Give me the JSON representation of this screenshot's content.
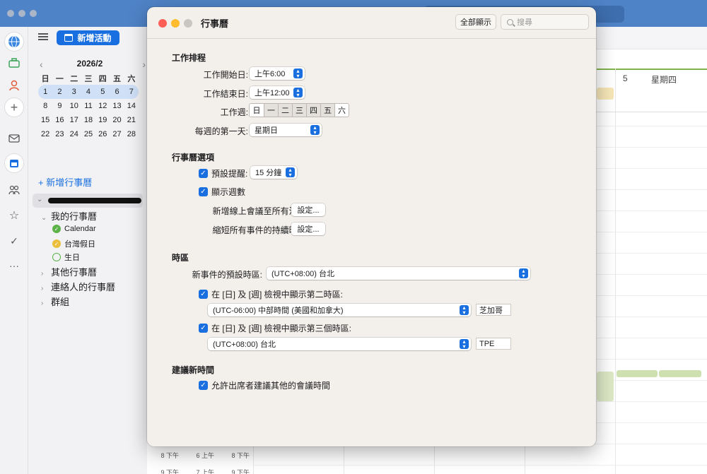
{
  "sidebar": {
    "new_event_label": "新增活動",
    "mini_cal": {
      "month_label": "2026/2",
      "dow": [
        "日",
        "一",
        "二",
        "三",
        "四",
        "五",
        "六"
      ],
      "weeks": [
        [
          "1",
          "2",
          "3",
          "4",
          "5",
          "6",
          "7"
        ],
        [
          "8",
          "9",
          "10",
          "11",
          "12",
          "13",
          "14"
        ],
        [
          "15",
          "16",
          "17",
          "18",
          "19",
          "20",
          "21"
        ],
        [
          "22",
          "23",
          "24",
          "25",
          "26",
          "27",
          "28"
        ]
      ]
    },
    "add_calendar": "+ 新增行事曆",
    "my_calendars": "我的行事曆",
    "cal_calendar": "Calendar",
    "cal_holidays": "台灣假日",
    "cal_birthdays": "生日",
    "other_calendars": "其他行事曆",
    "contacts_calendars": "連絡人的行事曆",
    "groups": "群組"
  },
  "main": {
    "day_num": "5",
    "day_name": "星期四",
    "time_rows": [
      {
        "a": "8 下午",
        "b": "6 上午",
        "c": "8 下午"
      },
      {
        "a": "9 下午",
        "b": "7 上午",
        "c": "9 下午"
      }
    ]
  },
  "dialog": {
    "title": "行事曆",
    "show_all": "全部顯示",
    "search_placeholder": "搜尋",
    "sections": {
      "work_schedule": "工作排程",
      "calendar_options": "行事曆選項",
      "time_zone": "時區",
      "propose_new_time": "建議新時間"
    },
    "work_start_label": "工作開始日:",
    "work_start_value": "上午6:00",
    "work_end_label": "工作結束日:",
    "work_end_value": "上午12:00",
    "work_week_label": "工作週:",
    "work_week_days": [
      "日",
      "一",
      "二",
      "三",
      "四",
      "五",
      "六"
    ],
    "week_start_label": "每週的第一天:",
    "week_start_value": "星期日",
    "default_reminder_label": "預設提醒:",
    "default_reminder_value": "15 分鐘",
    "show_week_numbers": "顯示週數",
    "add_online_meeting_label": "新增線上會議至所有活動:",
    "shorten_duration_label": "縮短所有事件的持續時間:",
    "settings_button": "設定...",
    "default_tz_label": "新事件的預設時區:",
    "default_tz_value": "(UTC+08:00) 台北",
    "show_second_tz": "在 [日] 及 [週] 檢視中顯示第二時區:",
    "second_tz_value": "(UTC-06:00) 中部時間 (美國和加拿大)",
    "second_tz_label": "芝加哥",
    "show_third_tz": "在 [日] 及 [週] 檢視中顯示第三個時區:",
    "third_tz_value": "(UTC+08:00) 台北",
    "third_tz_label": "TPE",
    "allow_propose": "允許出席者建議其他的會議時間"
  }
}
